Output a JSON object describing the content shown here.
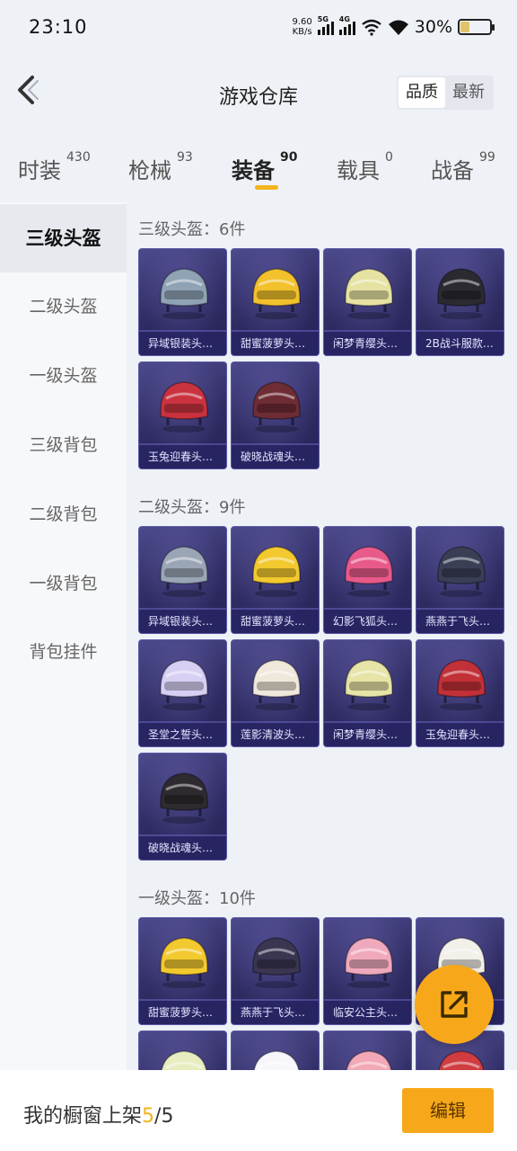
{
  "status_bar": {
    "time": "23:10",
    "net_speed_value": "9.60",
    "net_speed_unit": "KB/s",
    "sim1": "5G",
    "sim2": "4G",
    "battery": "30%",
    "battery_level": 0.3
  },
  "header": {
    "title": "游戏仓库",
    "sort_options": [
      "品质",
      "最新"
    ],
    "sort_selected": "品质"
  },
  "tabs": [
    {
      "label": "时装",
      "count": "430"
    },
    {
      "label": "枪械",
      "count": "93"
    },
    {
      "label": "装备",
      "count": "90",
      "active": true
    },
    {
      "label": "载具",
      "count": "0"
    },
    {
      "label": "战备",
      "count": "99"
    }
  ],
  "sidebar": {
    "items": [
      "三级头盔",
      "二级头盔",
      "一级头盔",
      "三级背包",
      "二级背包",
      "一级背包",
      "背包挂件"
    ],
    "active": "三级头盔"
  },
  "sections": [
    {
      "title": "三级头盔：6件",
      "items": [
        {
          "name": "异域银装头…",
          "color": "#8fa3b4"
        },
        {
          "name": "甜蜜菠萝头…",
          "color": "#f2c12c"
        },
        {
          "name": "闲梦青缨头…",
          "color": "#e6e2a2"
        },
        {
          "name": "2B战斗服款…",
          "color": "#2a2a30"
        },
        {
          "name": "玉兔迎春头…",
          "color": "#c9323e"
        },
        {
          "name": "破晓战魂头…",
          "color": "#6e2c34"
        }
      ]
    },
    {
      "title": "二级头盔：9件",
      "items": [
        {
          "name": "异域银装头…",
          "color": "#9aa6b6"
        },
        {
          "name": "甜蜜菠萝头…",
          "color": "#f2c92e"
        },
        {
          "name": "幻影飞狐头…",
          "color": "#e85a8a"
        },
        {
          "name": "燕燕于飞头…",
          "color": "#3a3f55"
        },
        {
          "name": "圣堂之誓头…",
          "color": "#d8d0f4"
        },
        {
          "name": "莲影清波头…",
          "color": "#f1e8dc"
        },
        {
          "name": "闲梦青缨头…",
          "color": "#e6e4a6"
        },
        {
          "name": "玉兔迎春头…",
          "color": "#c23038"
        },
        {
          "name": "破晓战魂头…",
          "color": "#2e2a30"
        }
      ]
    },
    {
      "title": "一级头盔：10件",
      "items": [
        {
          "name": "甜蜜菠萝头…",
          "color": "#f2c92e"
        },
        {
          "name": "燕燕于飞头…",
          "color": "#3a3550"
        },
        {
          "name": "临安公主头…",
          "color": "#f0a9bc"
        },
        {
          "name": "",
          "color": "#f3efe9"
        },
        {
          "name": "",
          "color": "#e8edbf"
        },
        {
          "name": "",
          "color": "#f7f7fb"
        },
        {
          "name": "",
          "color": "#f2a8b6"
        },
        {
          "name": "",
          "color": "#d03c40"
        }
      ]
    }
  ],
  "bottom_bar": {
    "label": "我的橱窗上架",
    "current": "5",
    "separator": "/",
    "total": "5",
    "edit_label": "编辑"
  }
}
